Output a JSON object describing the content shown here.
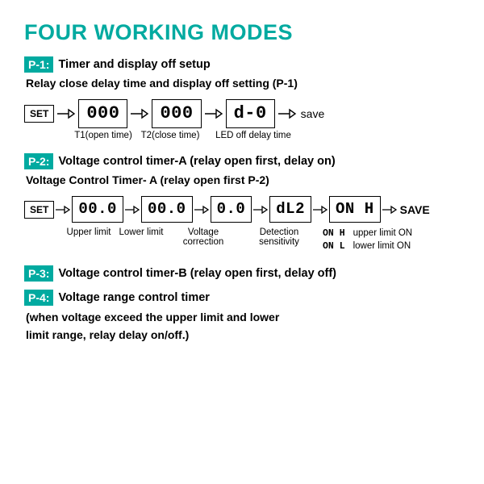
{
  "title": "FOUR WORKING MODES",
  "p1": {
    "badge": "P-1:",
    "title": "Timer and display off setup",
    "sub": "Relay close delay time and display off setting (P-1)",
    "set": "SET",
    "box1": "000",
    "box2": "000",
    "box3": "d-0",
    "save": "save",
    "cap1": "T1(open time)",
    "cap2": "T2(close time)",
    "cap3": "LED off delay time"
  },
  "p2": {
    "badge": "P-2:",
    "title": "Voltage control timer-A (relay open first, delay on)",
    "sub": "Voltage Control Timer- A (relay open first P-2)",
    "set": "SET",
    "box1": "00.0",
    "box2": "00.0",
    "box3": "0.0",
    "box4": "dL2",
    "box5": "ON H",
    "save": "SAVE",
    "cap1": "Upper limit",
    "cap2": "Lower limit",
    "cap3": "Voltage correction",
    "cap4": "Detection sensitivity",
    "leg1code": "ON H",
    "leg1txt": "upper limit ON",
    "leg2code": "ON L",
    "leg2txt": "lower limit ON"
  },
  "p3": {
    "badge": "P-3:",
    "title": "Voltage control timer-B (relay open first, delay off)"
  },
  "p4": {
    "badge": "P-4:",
    "title": "Voltage range control timer",
    "line1": "(when voltage exceed the upper limit and lower",
    "line2": "limit range, relay delay on/off.)"
  }
}
